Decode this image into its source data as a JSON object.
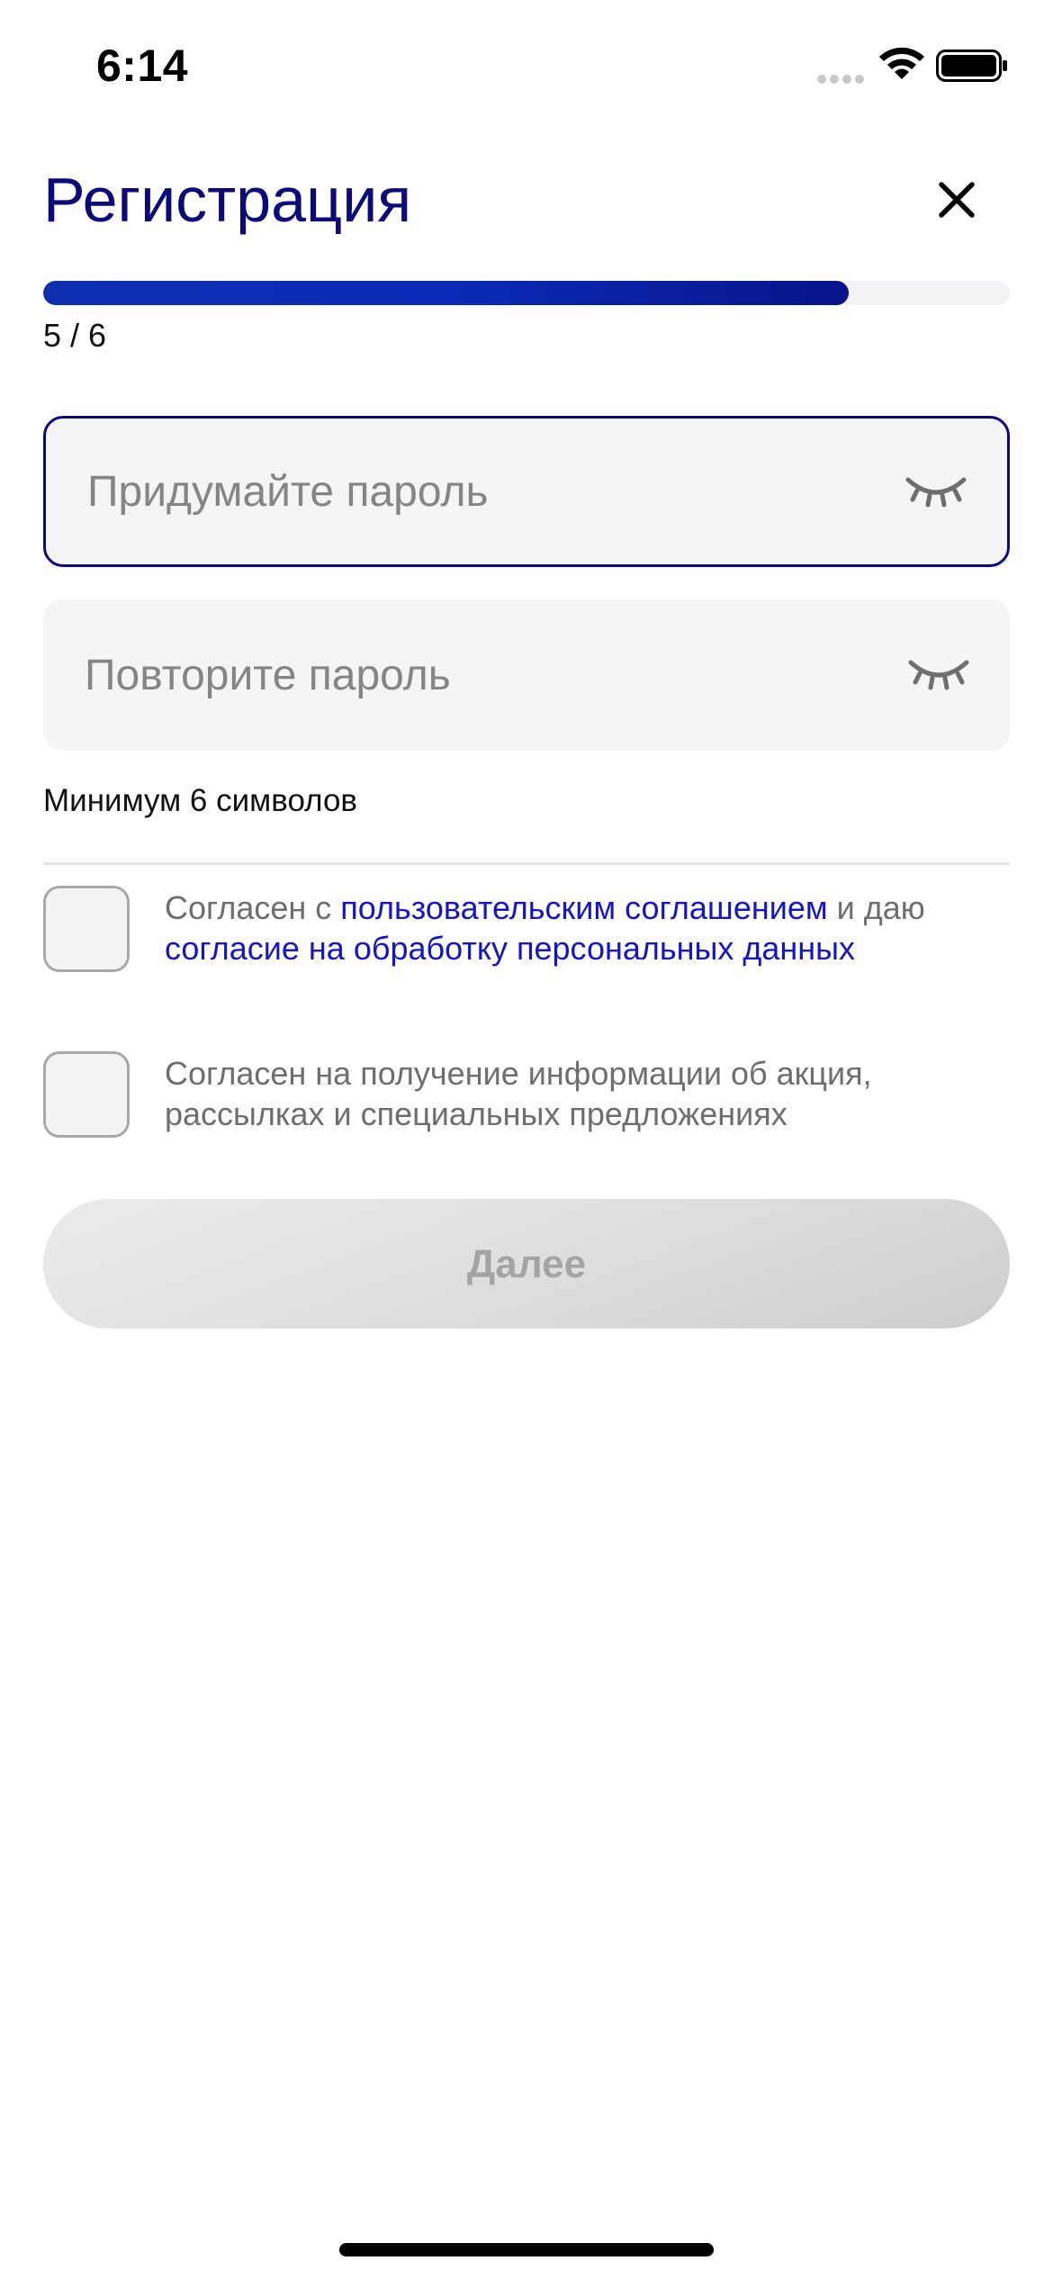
{
  "status_bar": {
    "time": "6:14"
  },
  "header": {
    "title": "Регистрация",
    "close_icon": "close-icon"
  },
  "progress": {
    "label": "5 / 6",
    "value": 0.8333,
    "fill_color": "#0a2bb8"
  },
  "form": {
    "password": {
      "placeholder": "Придумайте пароль",
      "value": "",
      "toggle_icon": "eye-closed-icon"
    },
    "password_repeat": {
      "placeholder": "Повторите пароль",
      "value": "",
      "toggle_icon": "eye-closed-icon"
    },
    "hint": "Минимум 6 символов"
  },
  "agreements": {
    "terms": {
      "checked": false,
      "text_before": "Согласен с ",
      "link1": "пользовательским соглашением",
      "text_middle": " и даю ",
      "link2": "согласие на обработку персональных данных"
    },
    "marketing": {
      "checked": false,
      "text": "Согласен на получение информации об акция, рассылках и специальных предложениях"
    }
  },
  "actions": {
    "next_label": "Далее"
  },
  "colors": {
    "title": "#0b0a7a",
    "link": "#1515c8",
    "active_border": "#0b0a7a",
    "button_disabled_text": "#a4a4a4"
  }
}
